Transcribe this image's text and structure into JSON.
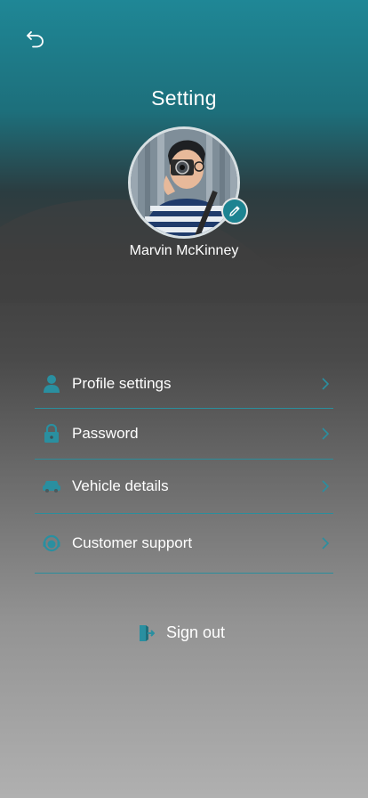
{
  "header": {
    "title": "Setting"
  },
  "profile": {
    "name": "Marvin McKinney"
  },
  "menu": {
    "items": [
      {
        "label": "Profile settings",
        "icon": "user-icon"
      },
      {
        "label": "Password",
        "icon": "lock-icon"
      },
      {
        "label": "Vehicle details",
        "icon": "car-icon"
      },
      {
        "label": "Customer support",
        "icon": "support-icon"
      }
    ]
  },
  "signout": {
    "label": "Sign out",
    "icon": "logout-icon"
  },
  "colors": {
    "accent": "#1d8391",
    "divider": "#2a8e9c",
    "icon": "#2a8fa0"
  }
}
